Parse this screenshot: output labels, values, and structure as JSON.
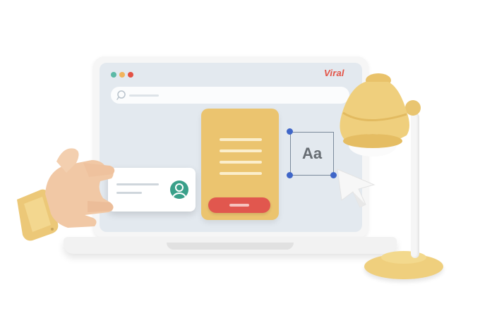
{
  "brand": {
    "logo_text": "Viral",
    "logo_color": "#e35245"
  },
  "window_controls": {
    "dots": [
      "green-dot",
      "orange-dot",
      "red-dot"
    ],
    "colors": [
      "#5bb9a6",
      "#f1b45c",
      "#e35245"
    ]
  },
  "text_tool": {
    "label": "Aa"
  },
  "colors": {
    "card": "#ebc46f",
    "card_button": "#e1574e",
    "handles": "#3f66c8",
    "lamp": "#efcf7d",
    "screen": "#e3e9ef"
  },
  "icons": [
    "search-icon",
    "user-avatar-icon",
    "cursor-arrow-icon",
    "desk-lamp-icon",
    "hand-icon"
  ]
}
